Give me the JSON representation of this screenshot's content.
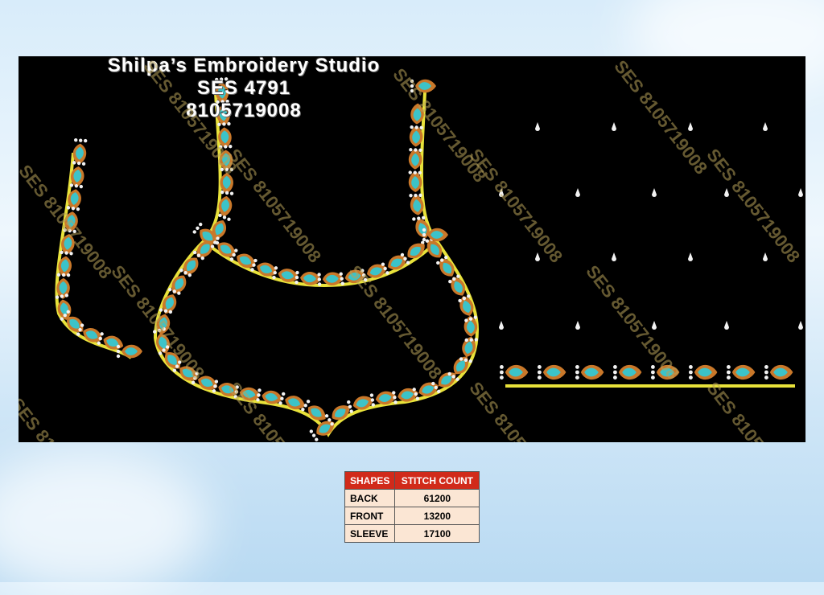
{
  "studio": {
    "name": "Shilpa’s Embroidery Studio",
    "code": "SES 4791",
    "phone": "8105719008"
  },
  "watermark": "SES 8105719008",
  "colors": {
    "background_fabric": "#000000",
    "outline": "#e8e23a",
    "motif_copper": "#c9782a",
    "motif_turquoise": "#3cc3c8",
    "beads": "#f2f2f2",
    "table_header": "#d12a1a",
    "table_cell": "#fbe6d4"
  },
  "stitch_table": {
    "headers": [
      "SHAPES",
      "STITCH COUNT"
    ],
    "rows": [
      {
        "shape": "BACK",
        "count": "61200"
      },
      {
        "shape": "FRONT",
        "count": "13200"
      },
      {
        "shape": "SLEEVE",
        "count": "17100"
      }
    ]
  }
}
